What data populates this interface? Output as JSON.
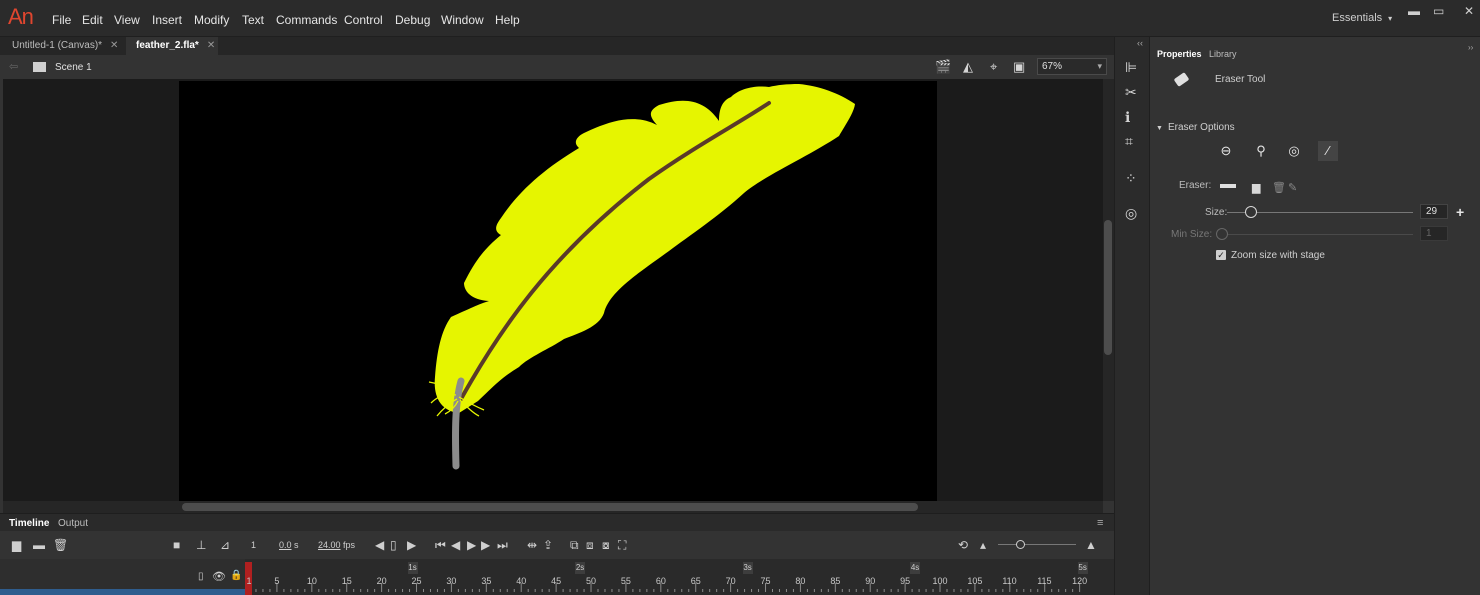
{
  "app": {
    "logo": "An"
  },
  "menu": [
    "File",
    "Edit",
    "View",
    "Insert",
    "Modify",
    "Text",
    "Commands",
    "Control",
    "Debug",
    "Window",
    "Help"
  ],
  "workspace": {
    "label": "Essentials"
  },
  "doc_tabs": [
    {
      "label": "Untitled-1 (Canvas)*",
      "active": false
    },
    {
      "label": "feather_2.fla*",
      "active": true
    }
  ],
  "scene": {
    "label": "Scene 1",
    "zoom": "67%"
  },
  "stage": {
    "background": "#000000",
    "feather_color": "#e6f500",
    "shaft_color": "#8c8c8c",
    "rachis_color": "#5a3a2a"
  },
  "timeline": {
    "tabs": [
      "Timeline",
      "Output"
    ],
    "current_frame": "1",
    "time": "0.0",
    "time_unit": "s",
    "fps": "24.00",
    "fps_unit": "fps",
    "seconds": [
      "1s",
      "2s",
      "3s",
      "4s",
      "5s"
    ],
    "frame_numbers": [
      "1",
      "5",
      "10",
      "15",
      "20",
      "25",
      "30",
      "35",
      "40",
      "45",
      "50",
      "55",
      "60",
      "65",
      "70",
      "75",
      "80",
      "85",
      "90",
      "95",
      "100",
      "105",
      "110",
      "115",
      "120"
    ]
  },
  "properties": {
    "tabs": [
      "Properties",
      "Library"
    ],
    "tool_name": "Eraser Tool",
    "section": "Eraser Options",
    "eraser_label": "Eraser:",
    "size_label": "Size:",
    "size_value": "29",
    "size_fraction": 0.13,
    "min_size_label": "Min Size:",
    "min_size_value": "1",
    "zoom_with_stage_label": "Zoom size with stage",
    "zoom_with_stage_checked": true
  }
}
